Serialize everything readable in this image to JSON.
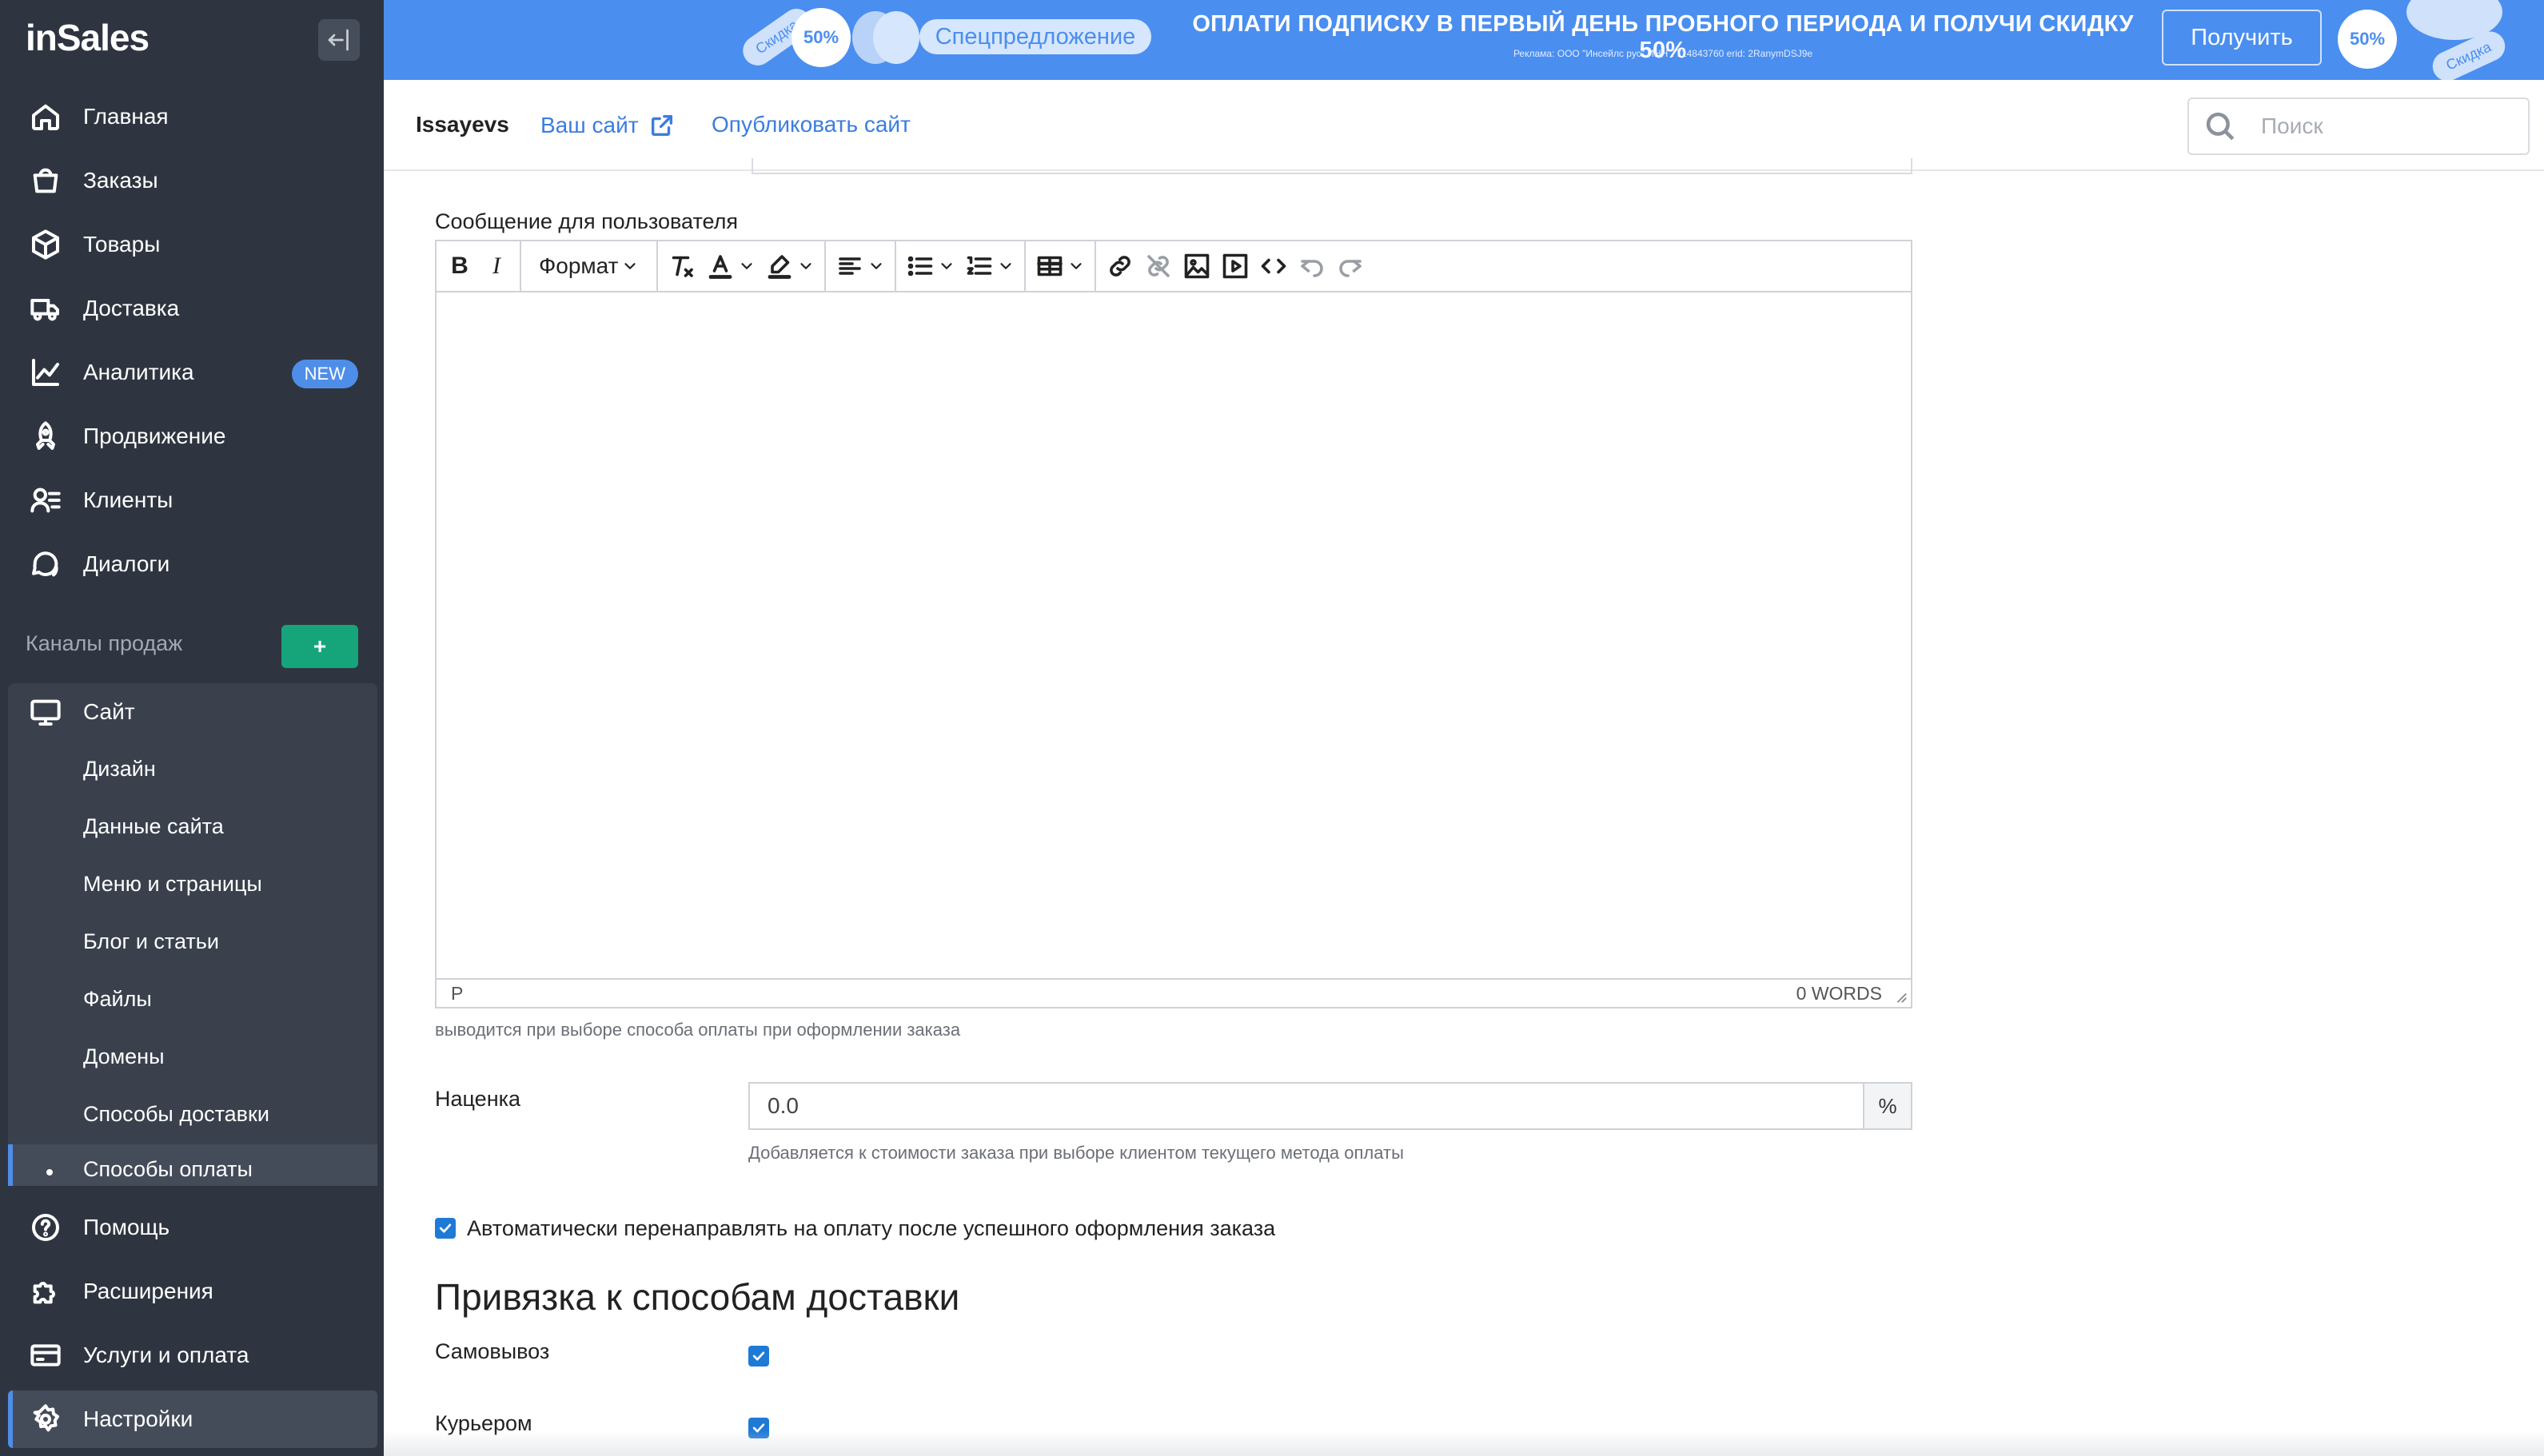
{
  "sidebar": {
    "logo": "inSales",
    "items": [
      {
        "label": "Главная",
        "icon": "home-icon"
      },
      {
        "label": "Заказы",
        "icon": "shopping-bag-icon"
      },
      {
        "label": "Товары",
        "icon": "box-icon"
      },
      {
        "label": "Доставка",
        "icon": "truck-icon"
      },
      {
        "label": "Аналитика",
        "icon": "chart-icon",
        "badge": "NEW"
      },
      {
        "label": "Продвижение",
        "icon": "rocket-icon"
      },
      {
        "label": "Клиенты",
        "icon": "clients-icon"
      },
      {
        "label": "Диалоги",
        "icon": "chat-icon"
      }
    ],
    "channels_label": "Каналы продаж",
    "add_channel_label": "+",
    "site": {
      "label": "Сайт",
      "icon": "monitor-icon"
    },
    "site_sub_items": [
      {
        "label": "Дизайн"
      },
      {
        "label": "Данные сайта"
      },
      {
        "label": "Меню и страницы"
      },
      {
        "label": "Блог и статьи"
      },
      {
        "label": "Файлы"
      },
      {
        "label": "Домены"
      },
      {
        "label": "Способы доставки"
      },
      {
        "label": "Способы оплаты",
        "active": true
      }
    ],
    "bottom_items": [
      {
        "label": "Помощь",
        "icon": "help-icon"
      },
      {
        "label": "Расширения",
        "icon": "puzzle-icon"
      },
      {
        "label": "Услуги и оплата",
        "icon": "card-icon"
      },
      {
        "label": "Настройки",
        "icon": "gear-icon",
        "active": true
      }
    ]
  },
  "banner": {
    "tag_left": "Скидка",
    "sticker_left": "50%",
    "special_offer": "Спецпредложение",
    "headline": "ОПЛАТИ ПОДПИСКУ В ПЕРВЫЙ ДЕНЬ ПРОБНОГО ПЕРИОДА И ПОЛУЧИ СКИДКУ 50%",
    "ad_note": "Реклама: ООО \"Инсейлс рус\" ИНН 7714843760 erid: 2RanymDSJ9e",
    "get_button": "Получить",
    "sticker_right": "50%",
    "tag_right": "Скидка"
  },
  "topbar": {
    "shop_name": "Issayevs",
    "your_site": "Ваш сайт",
    "publish_site": "Опубликовать сайт",
    "search_placeholder": "Поиск"
  },
  "form": {
    "message_label": "Сообщение для пользователя",
    "toolbar": {
      "bold": "B",
      "italic": "I",
      "format": "Формат"
    },
    "editor_path": "P",
    "word_count": "0 WORDS",
    "message_hint": "выводится при выборе способа оплаты при оформлении заказа",
    "markup_label": "Наценка",
    "markup_value": "0.0",
    "markup_unit": "%",
    "markup_hint": "Добавляется к стоимости заказа при выборе клиентом текущего метода оплаты",
    "auto_redirect_label": "Автоматически перенаправлять на оплату после успешного оформления заказа",
    "auto_redirect_checked": true,
    "delivery_section_title": "Привязка к способам доставки",
    "delivery_methods": [
      {
        "label": "Самовывоз",
        "checked": true
      },
      {
        "label": "Курьером",
        "checked": true
      }
    ]
  },
  "colors": {
    "sidebar_bg": "#2f3540",
    "banner_bg": "#4a8ef0",
    "accent": "#3b7de0",
    "add_button": "#16a57b",
    "checkbox": "#1f7ad6"
  }
}
